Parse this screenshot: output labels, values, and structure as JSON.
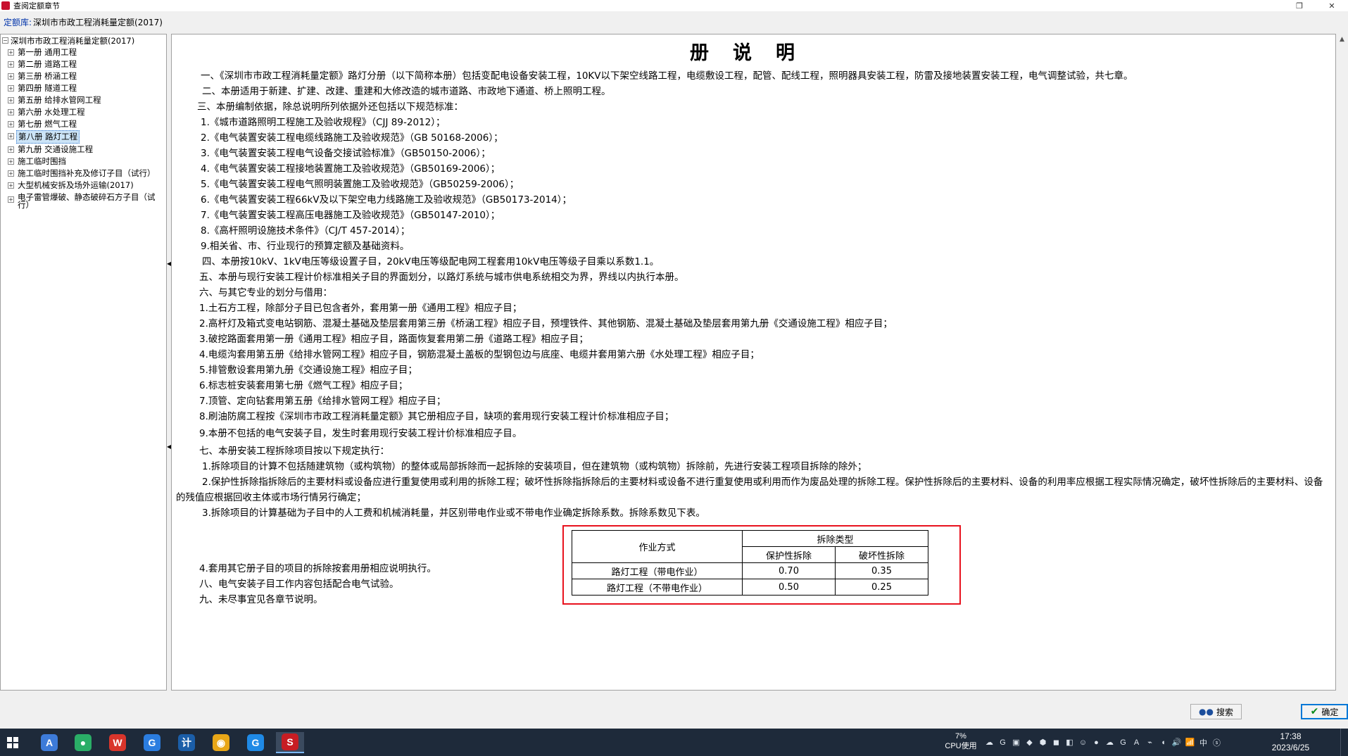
{
  "window": {
    "title": "查阅定额章节",
    "restore_glyph": "❐",
    "close_glyph": "✕"
  },
  "library": {
    "label": "定额库:",
    "value": "深圳市市政工程消耗量定额(2017)"
  },
  "tree": {
    "root": "深圳市市政工程消耗量定额(2017)",
    "items": [
      {
        "label": "第一册 通用工程",
        "selected": false
      },
      {
        "label": "第二册 道路工程",
        "selected": false
      },
      {
        "label": "第三册 桥涵工程",
        "selected": false
      },
      {
        "label": "第四册 隧道工程",
        "selected": false
      },
      {
        "label": "第五册 给排水管网工程",
        "selected": false
      },
      {
        "label": "第六册 水处理工程",
        "selected": false
      },
      {
        "label": "第七册 燃气工程",
        "selected": false
      },
      {
        "label": "第八册 路灯工程",
        "selected": true
      },
      {
        "label": "第九册 交通设施工程",
        "selected": false
      },
      {
        "label": "施工临时围挡",
        "selected": false
      },
      {
        "label": "施工临时围挡补充及修订子目（试行）",
        "selected": false
      },
      {
        "label": "大型机械安拆及场外运输(2017)",
        "selected": false
      },
      {
        "label": "电子雷管爆破、静态破碎石方子目（试行）",
        "selected": false
      }
    ]
  },
  "document": {
    "title": "册说明",
    "lines": [
      "一、《深圳市市政工程消耗量定额》路灯分册（以下简称本册）包括变配电设备安装工程，10KV以下架空线路工程，电缆敷设工程，配管、配线工程，照明器具安装工程，防雷及接地装置安装工程，电气调整试验，共七章。",
      "二、本册适用于新建、扩建、改建、重建和大修改造的城市道路、市政地下通道、桥上照明工程。",
      "三、本册编制依据，除总说明所列依据外还包括以下规范标准：",
      "1.《城市道路照明工程施工及验收规程》（CJJ 89-2012）；",
      "2.《电气装置安装工程电缆线路施工及验收规范》（GB 50168-2006）；",
      "3.《电气装置安装工程电气设备交接试验标准》（GB50150-2006）；",
      "4.《电气装置安装工程接地装置施工及验收规范》（GB50169-2006）；",
      "5.《电气装置安装工程电气照明装置施工及验收规范》（GB50259-2006）；",
      "6.《电气装置安装工程66kV及以下架空电力线路施工及验收规范》（GB50173-2014）；",
      "7.《电气装置安装工程高压电器施工及验收规范》（GB50147-2010）；",
      "8.《高杆照明设施技术条件》（CJ/T 457-2014）；",
      "9.相关省、市、行业现行的预算定额及基础资料。",
      "四、本册按10kV、1kV电压等级设置子目，20kV电压等级配电网工程套用10kV电压等级子目乘以系数1.1。",
      "五、本册与现行安装工程计价标准相关子目的界面划分，以路灯系统与城市供电系统相交为界，界线以内执行本册。",
      "六、与其它专业的划分与借用：",
      "1.土石方工程，除部分子目已包含者外，套用第一册《通用工程》相应子目；",
      "2.高杆灯及箱式变电站钢筋、混凝土基础及垫层套用第三册《桥涵工程》相应子目，预埋铁件、其他钢筋、混凝土基础及垫层套用第九册《交通设施工程》相应子目；",
      "3.破挖路面套用第一册《通用工程》相应子目，路面恢复套用第二册《道路工程》相应子目；",
      "4.电缆沟套用第五册《给排水管网工程》相应子目，钢筋混凝土盖板的型钢包边与底座、电缆井套用第六册《水处理工程》相应子目；",
      "5.排管敷设套用第九册《交通设施工程》相应子目；",
      "6.标志桩安装套用第七册《燃气工程》相应子目；",
      "7.顶管、定向钻套用第五册《给排水管网工程》相应子目；",
      "8.刷油防腐工程按《深圳市市政工程消耗量定额》其它册相应子目，缺项的套用现行安装工程计价标准相应子目；",
      "9.本册不包括的电气安装子目，发生时套用现行安装工程计价标准相应子目。",
      "七、本册安装工程拆除项目按以下规定执行：",
      "1.拆除项目的计算不包括随建筑物（或构筑物）的整体或局部拆除而一起拆除的安装项目，但在建筑物（或构筑物）拆除前，先进行安装工程项目拆除的除外；",
      "2.保护性拆除指拆除后的主要材料或设备应进行重复使用或利用的拆除工程；破坏性拆除指拆除后的主要材料或设备不进行重复使用或利用而作为废品处理的拆除工程。保护性拆除后的主要材料、设备的利用率应根据工程实际情况确定，破坏性拆除后的主要材料、设备的残值应根据回收主体或市场行情另行确定；",
      "3.拆除项目的计算基础为子目中的人工费和机械消耗量，并区别带电作业或不带电作业确定拆除系数。拆除系数见下表。",
      "4.套用其它册子目的项目的拆除按套用册相应说明执行。",
      "八、电气安装子目工作内容包括配合电气试验。",
      "九、未尽事宜见各章节说明。"
    ],
    "table": {
      "col_mode": "作业方式",
      "col_group": "拆除类型",
      "col_protective": "保护性拆除",
      "col_destructive": "破坏性拆除",
      "rows": [
        {
          "mode": "路灯工程（带电作业）",
          "protective": "0.70",
          "destructive": "0.35"
        },
        {
          "mode": "路灯工程（不带电作业）",
          "protective": "0.50",
          "destructive": "0.25"
        }
      ]
    }
  },
  "buttons": {
    "search": "搜索",
    "ok": "确定"
  },
  "taskbar": {
    "apps": [
      {
        "name": "a-app",
        "glyph": "A",
        "color": "#3d7bd9"
      },
      {
        "name": "wechat",
        "glyph": "●",
        "color": "#2aae67"
      },
      {
        "name": "wps",
        "glyph": "W",
        "color": "#d9352b"
      },
      {
        "name": "g-app-1",
        "glyph": "G",
        "color": "#2b7de0"
      },
      {
        "name": "calc-app",
        "glyph": "计",
        "color": "#1b5ea8"
      },
      {
        "name": "chrome",
        "glyph": "◉",
        "color": "#e8a617"
      },
      {
        "name": "g-app-2",
        "glyph": "G",
        "color": "#1f8ae6"
      },
      {
        "name": "s-app",
        "glyph": "S",
        "color": "#c71d23"
      }
    ],
    "cpu_percent": "7%",
    "cpu_label": "CPU使用",
    "tray_icons": [
      "☁",
      "G",
      "▣",
      "◆",
      "⬢",
      "◼",
      "◧",
      "☺",
      "●",
      "☁",
      "G",
      "A",
      "⌁",
      "◖",
      "🔊",
      "📶",
      "中",
      "ⓢ"
    ],
    "time": "17:38",
    "date": "2023/6/25"
  }
}
